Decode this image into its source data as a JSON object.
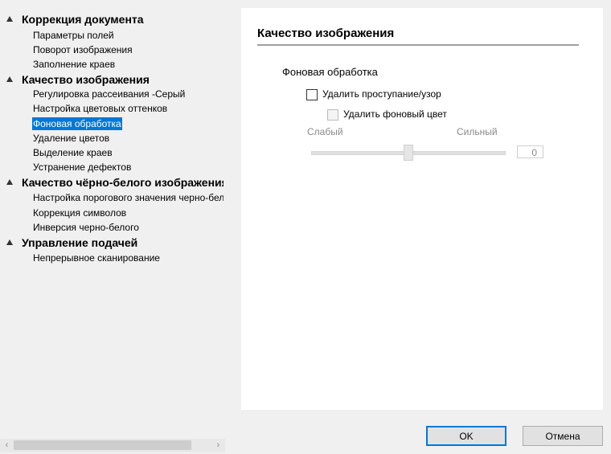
{
  "tree": {
    "groups": [
      {
        "label": "Коррекция документа",
        "items": [
          "Параметры полей",
          "Поворот изображения",
          "Заполнение краев"
        ]
      },
      {
        "label": "Качество изображения",
        "items": [
          "Регулировка рассеивания -Серый",
          "Настройка цветовых оттенков",
          "Фоновая обработка",
          "Удаление цветов",
          "Выделение краев",
          "Устранение дефектов"
        ]
      },
      {
        "label": "Качество чёрно-белого изображения",
        "items": [
          "Настройка порогового значения черно-белого",
          "Коррекция символов",
          "Инверсия черно-белого"
        ]
      },
      {
        "label": "Управление подачей",
        "items": [
          "Непрерывное сканирование"
        ]
      }
    ],
    "selected": "Фоновая обработка"
  },
  "panel": {
    "title": "Качество изображения",
    "section": "Фоновая обработка",
    "remove_bleed_label": "Удалить проступание/узор",
    "remove_bleed_checked": false,
    "remove_bg_color_label": "Удалить фоновый цвет",
    "remove_bg_color_checked": false,
    "remove_bg_color_enabled": false,
    "slider_min_label": "Слабый",
    "slider_max_label": "Сильный",
    "slider_value": "0",
    "slider_level": 0.5
  },
  "buttons": {
    "ok": "OK",
    "cancel": "Отмена"
  },
  "colors": {
    "selection": "#0078d7",
    "panel_bg": "#ffffff",
    "window_bg": "#f0f0f0"
  }
}
